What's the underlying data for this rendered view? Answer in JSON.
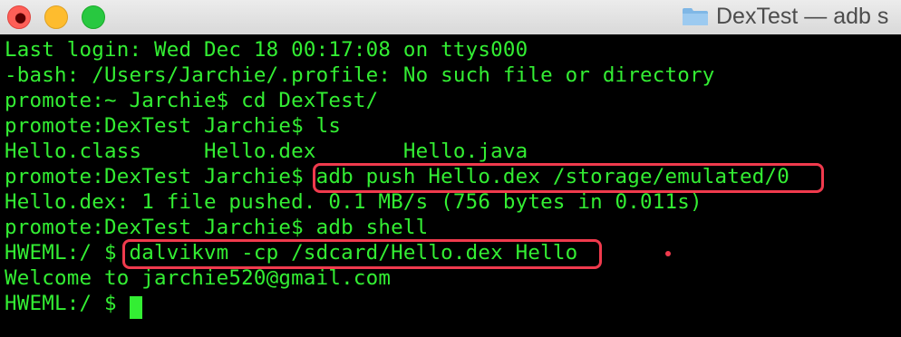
{
  "window": {
    "title": "DexTest — adb s",
    "close_glyph": "●"
  },
  "terminal": {
    "lines": [
      "Last login: Wed Dec 18 00:17:08 on ttys000",
      "-bash: /Users/Jarchie/.profile: No such file or directory",
      "promote:~ Jarchie$ cd DexTest/",
      "promote:DexTest Jarchie$ ls",
      "Hello.class     Hello.dex       Hello.java",
      "promote:DexTest Jarchie$ adb push Hello.dex /storage/emulated/0",
      "Hello.dex: 1 file pushed. 0.1 MB/s (756 bytes in 0.011s)",
      "promote:DexTest Jarchie$ adb shell",
      "HWEML:/ $ dalvikvm -cp /sdcard/Hello.dex Hello",
      "Welcome to jarchie520@gmail.com",
      "HWEML:/ $ "
    ]
  },
  "colors": {
    "text": "#33ee33",
    "highlight": "#f03a4d",
    "background": "#000000"
  }
}
